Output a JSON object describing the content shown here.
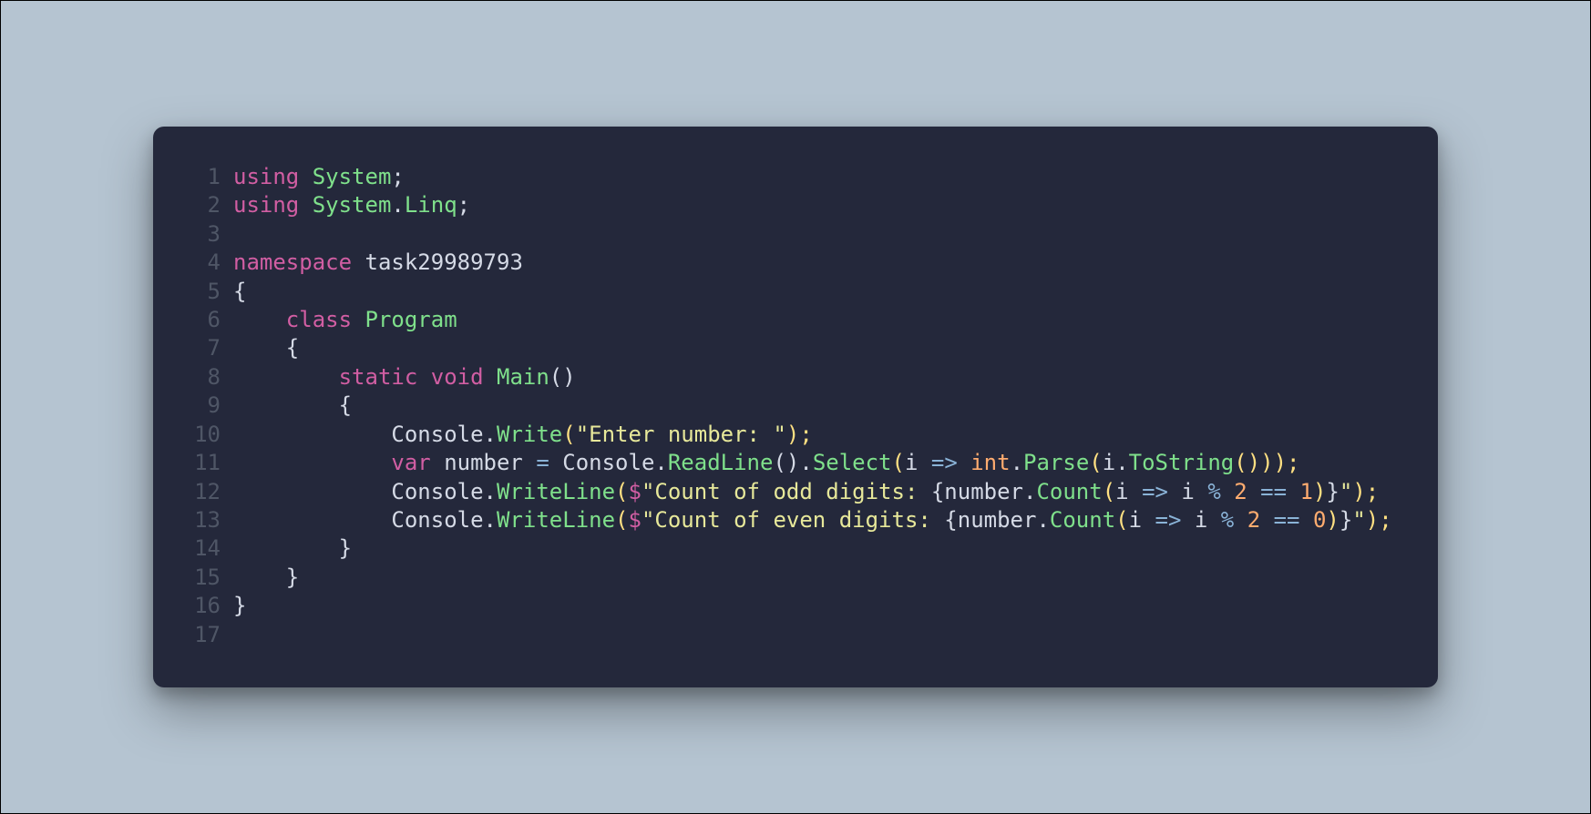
{
  "code": {
    "line_count": 17,
    "lines": {
      "l1": {
        "kw1": "using ",
        "t1": "System",
        "p1": ";"
      },
      "l2": {
        "kw1": "using ",
        "t1": "System",
        "p1": ".",
        "t2": "Linq",
        "p2": ";"
      },
      "l4": {
        "kw1": "namespace ",
        "ns": "task29989793"
      },
      "l5": {
        "p1": "{"
      },
      "l6": {
        "indent": "    ",
        "kw1": "class ",
        "t1": "Program"
      },
      "l7": {
        "indent": "    ",
        "p1": "{"
      },
      "l8": {
        "indent": "        ",
        "kw1": "static ",
        "kw2": "void ",
        "m1": "Main",
        "p1": "()"
      },
      "l9": {
        "indent": "        ",
        "p1": "{"
      },
      "l10": {
        "indent": "            ",
        "id1": "Console",
        "p1": ".",
        "m1": "Write",
        "p2": "(",
        "s1": "\"Enter number: \"",
        "p3": ");"
      },
      "l11": {
        "indent": "            ",
        "kw1": "var ",
        "id1": "number ",
        "op1": "= ",
        "id2": "Console",
        "p1": ".",
        "m1": "ReadLine",
        "p2": "().",
        "m2": "Select",
        "p3": "(",
        "id3": "i ",
        "op2": "=> ",
        "int": "int",
        "p4": ".",
        "m3": "Parse",
        "p5": "(",
        "id4": "i",
        "p6": ".",
        "m4": "ToString",
        "p7": "()));"
      },
      "l12": {
        "indent": "            ",
        "id1": "Console",
        "p1": ".",
        "m1": "WriteLine",
        "p2": "(",
        "d1": "$",
        "s1": "\"Count of odd digits: ",
        "br1": "{",
        "id2": "number",
        "p3": ".",
        "m2": "Count",
        "p4": "(",
        "id3": "i ",
        "op1": "=> ",
        "id4": "i ",
        "op2": "% ",
        "n1": "2 ",
        "op3": "== ",
        "n2": "1",
        "p5": ")",
        "br2": "}",
        "s2": "\"",
        "p6": ");"
      },
      "l13": {
        "indent": "            ",
        "id1": "Console",
        "p1": ".",
        "m1": "WriteLine",
        "p2": "(",
        "d1": "$",
        "s1": "\"Count of even digits: ",
        "br1": "{",
        "id2": "number",
        "p3": ".",
        "m2": "Count",
        "p4": "(",
        "id3": "i ",
        "op1": "=> ",
        "id4": "i ",
        "op2": "% ",
        "n1": "2 ",
        "op3": "== ",
        "n2": "0",
        "p5": ")",
        "br2": "}",
        "s2": "\"",
        "p6": ");"
      },
      "l14": {
        "indent": "        ",
        "p1": "}"
      },
      "l15": {
        "indent": "    ",
        "p1": "}"
      },
      "l16": {
        "p1": "}"
      }
    }
  }
}
